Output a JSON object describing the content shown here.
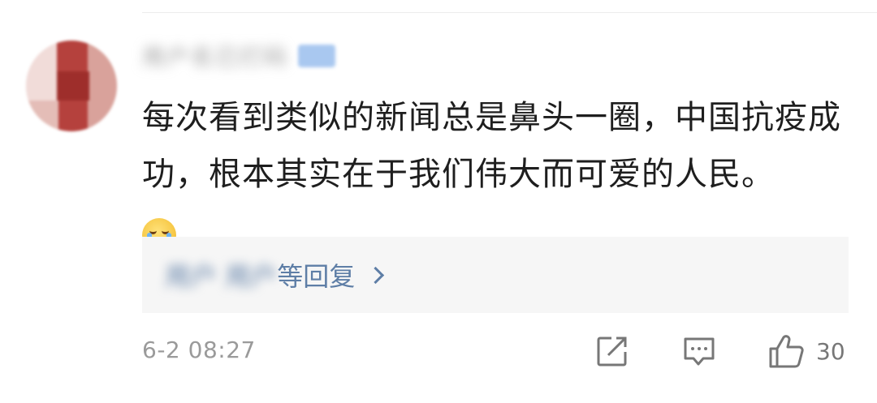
{
  "comment": {
    "username": "用户名已打码",
    "text": "每次看到类似的新闻总是鼻头一圈，中国抗疫成功，根本其实在于我们伟大而可爱的人民。",
    "emoji_icon": "crying-face-icon",
    "replies": {
      "names_blurred": "用户 用户",
      "label": "等回复"
    },
    "timestamp": "6-2 08:27",
    "actions": {
      "share_icon": "share-icon",
      "reply_icon": "comment-icon",
      "like_icon": "thumbs-up-icon",
      "like_count": "30"
    }
  },
  "colors": {
    "link": "#5e7ea6",
    "text": "#1e1e1e",
    "muted": "#9a9a9a",
    "reply_bg": "#f6f6f6"
  }
}
